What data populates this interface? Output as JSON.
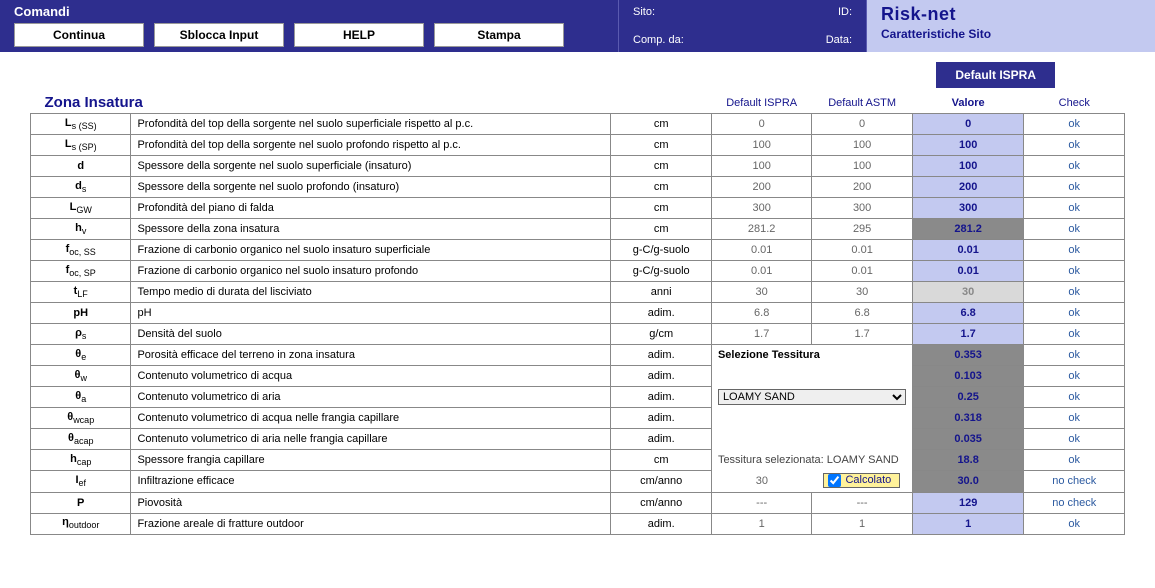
{
  "header": {
    "commands_label": "Comandi",
    "buttons": {
      "continua": "Continua",
      "sblocca": "Sblocca Input",
      "help": "HELP",
      "stampa": "Stampa"
    },
    "meta": {
      "sito_label": "Sito:",
      "sito_value": "",
      "id_label": "ID:",
      "id_value": "",
      "comp_label": "Comp. da:",
      "comp_value": "",
      "data_label": "Data:",
      "data_value": ""
    },
    "brand": "Risk-net",
    "subtitle": "Caratteristiche Sito"
  },
  "default_ispra_btn": "Default ISPRA",
  "section_title": "Zona Insatura",
  "col_headers": {
    "dispra": "Default ISPRA",
    "dastm": "Default ASTM",
    "valore": "Valore",
    "check": "Check"
  },
  "tessitura": {
    "label": "Selezione Tessitura",
    "selected": "LOAMY SAND",
    "note_prefix": "Tessitura selezionata: ",
    "note_value": "LOAMY SAND",
    "calcolato_label": "Calcolato",
    "calcolato_checked": true
  },
  "rows": [
    {
      "sym_html": "L<sub>s (SS)</sub>",
      "desc": "Profondità del top della sorgente nel suolo superficiale rispetto al p.c.",
      "unit": "cm",
      "dispra": "0",
      "dastm": "0",
      "val": "0",
      "val_style": "light",
      "check": "ok"
    },
    {
      "sym_html": "L<sub>s (SP)</sub>",
      "desc": "Profondità del top della sorgente nel suolo profondo rispetto al p.c.",
      "unit": "cm",
      "dispra": "100",
      "dastm": "100",
      "val": "100",
      "val_style": "light",
      "check": "ok"
    },
    {
      "sym_html": "d",
      "desc": "Spessore della sorgente nel suolo superficiale (insaturo)",
      "unit": "cm",
      "dispra": "100",
      "dastm": "100",
      "val": "100",
      "val_style": "light",
      "check": "ok"
    },
    {
      "sym_html": "d<sub>s</sub>",
      "desc": "Spessore della sorgente nel suolo profondo (insaturo)",
      "unit": "cm",
      "dispra": "200",
      "dastm": "200",
      "val": "200",
      "val_style": "light",
      "check": "ok"
    },
    {
      "sym_html": "L<sub>GW</sub>",
      "desc": "Profondità del piano di falda",
      "unit": "cm",
      "dispra": "300",
      "dastm": "300",
      "val": "300",
      "val_style": "light",
      "check": "ok"
    },
    {
      "sym_html": "h<sub>v</sub>",
      "desc": "Spessore della zona insatura",
      "unit": "cm",
      "dispra": "281.2",
      "dastm": "295",
      "val": "281.2",
      "val_style": "dark",
      "check": "ok"
    },
    {
      "sym_html": "f<sub>oc, SS</sub>",
      "desc": "Frazione di carbonio organico nel suolo insaturo superficiale",
      "unit": "g-C/g-suolo",
      "dispra": "0.01",
      "dastm": "0.01",
      "val": "0.01",
      "val_style": "light",
      "check": "ok"
    },
    {
      "sym_html": "f<sub>oc, SP</sub>",
      "desc": "Frazione di carbonio organico nel suolo insaturo profondo",
      "unit": "g-C/g-suolo",
      "dispra": "0.01",
      "dastm": "0.01",
      "val": "0.01",
      "val_style": "light",
      "check": "ok"
    },
    {
      "sym_html": "t<sub>LF</sub>",
      "desc": "Tempo medio di durata del lisciviato",
      "unit": "anni",
      "dispra": "30",
      "dastm": "30",
      "val": "30",
      "val_style": "grey",
      "check": "ok"
    },
    {
      "sym_html": "pH",
      "desc": "pH",
      "unit": "adim.",
      "dispra": "6.8",
      "dastm": "6.8",
      "val": "6.8",
      "val_style": "light",
      "check": "ok"
    },
    {
      "sym_html": "ρ<sub>s</sub>",
      "desc": "Densità del suolo",
      "unit": "g/cm",
      "dispra": "1.7",
      "dastm": "1.7",
      "val": "1.7",
      "val_style": "light",
      "check": "ok"
    },
    {
      "sym_html": "θ<sub>e</sub>",
      "desc": "Porosità efficace del terreno in zona insatura",
      "unit": "adim.",
      "dispra": "",
      "dastm": "",
      "val": "0.353",
      "val_style": "dark",
      "check": "ok",
      "tess_label": true
    },
    {
      "sym_html": "θ<sub>w</sub>",
      "desc": "Contenuto volumetrico di acqua",
      "unit": "adim.",
      "dispra": "",
      "dastm": "",
      "val": "0.103",
      "val_style": "dark",
      "check": "ok"
    },
    {
      "sym_html": "θ<sub>a</sub>",
      "desc": "Contenuto volumetrico di aria",
      "unit": "adim.",
      "dispra": "",
      "dastm": "",
      "val": "0.25",
      "val_style": "dark",
      "check": "ok",
      "tess_select": true
    },
    {
      "sym_html": "θ<sub>wcap</sub>",
      "desc": "Contenuto volumetrico di acqua nelle frangia capillare",
      "unit": "adim.",
      "dispra": "",
      "dastm": "",
      "val": "0.318",
      "val_style": "dark",
      "check": "ok"
    },
    {
      "sym_html": "θ<sub>acap</sub>",
      "desc": "Contenuto volumetrico di aria nelle frangia capillare",
      "unit": "adim.",
      "dispra": "",
      "dastm": "",
      "val": "0.035",
      "val_style": "dark",
      "check": "ok"
    },
    {
      "sym_html": "h<sub>cap</sub>",
      "desc": "Spessore frangia capillare",
      "unit": "cm",
      "dispra": "",
      "dastm": "",
      "val": "18.8",
      "val_style": "dark",
      "check": "ok",
      "tess_note": true
    },
    {
      "sym_html": "I<sub>ef</sub>",
      "desc": "Infiltrazione efficace",
      "unit": "cm/anno",
      "dispra": "30",
      "dastm": "",
      "val": "30.0",
      "val_style": "dark",
      "check": "no check",
      "ief": true
    },
    {
      "sym_html": "P",
      "desc": "Piovosità",
      "unit": "cm/anno",
      "dispra": "---",
      "dastm": "---",
      "val": "129",
      "val_style": "light",
      "check": "no check"
    },
    {
      "sym_html": "η<sub>outdoor</sub>",
      "desc": "Frazione areale di fratture outdoor",
      "unit": "adim.",
      "dispra": "1",
      "dastm": "1",
      "val": "1",
      "val_style": "light",
      "check": "ok"
    }
  ]
}
